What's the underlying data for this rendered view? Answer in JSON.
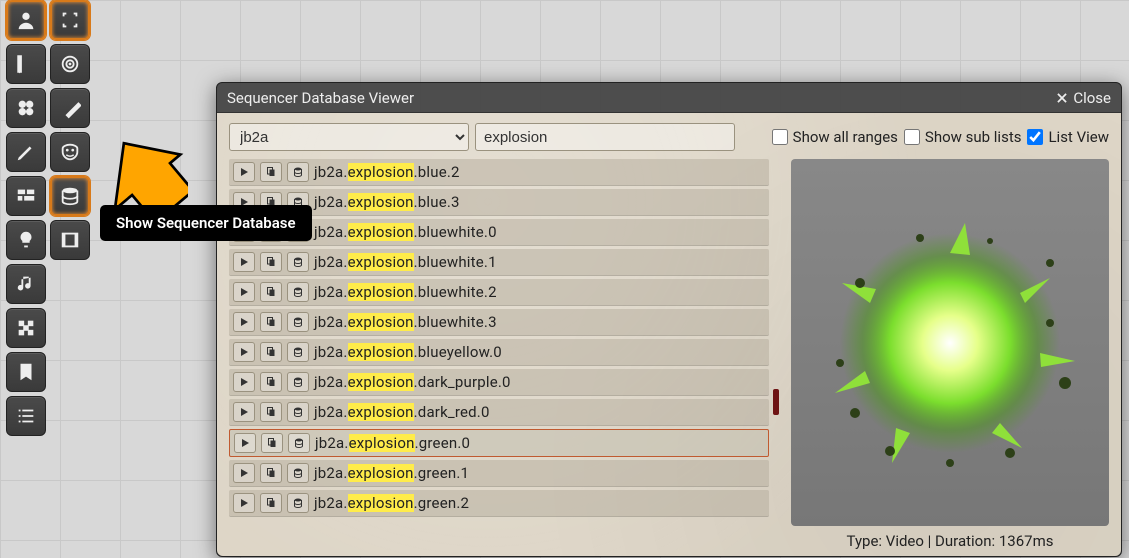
{
  "tooltip": "Show Sequencer Database",
  "window": {
    "title": "Sequencer Database Viewer",
    "close_label": "Close"
  },
  "controls": {
    "select_value": "jb2a",
    "search_value": "explosion",
    "show_all_ranges": {
      "label": "Show all ranges",
      "checked": false
    },
    "show_sub_lists": {
      "label": "Show sub lists",
      "checked": false
    },
    "list_view": {
      "label": "List View",
      "checked": true
    }
  },
  "rows": [
    {
      "pre": "jb2a.",
      "hl": "explosion",
      "post": ".blue.2"
    },
    {
      "pre": "jb2a.",
      "hl": "explosion",
      "post": ".blue.3"
    },
    {
      "pre": "jb2a.",
      "hl": "explosion",
      "post": ".bluewhite.0"
    },
    {
      "pre": "jb2a.",
      "hl": "explosion",
      "post": ".bluewhite.1"
    },
    {
      "pre": "jb2a.",
      "hl": "explosion",
      "post": ".bluewhite.2"
    },
    {
      "pre": "jb2a.",
      "hl": "explosion",
      "post": ".bluewhite.3"
    },
    {
      "pre": "jb2a.",
      "hl": "explosion",
      "post": ".blueyellow.0"
    },
    {
      "pre": "jb2a.",
      "hl": "explosion",
      "post": ".dark_purple.0"
    },
    {
      "pre": "jb2a.",
      "hl": "explosion",
      "post": ".dark_red.0"
    },
    {
      "pre": "jb2a.",
      "hl": "explosion",
      "post": ".green.0",
      "selected": true
    },
    {
      "pre": "jb2a.",
      "hl": "explosion",
      "post": ".green.1"
    },
    {
      "pre": "jb2a.",
      "hl": "explosion",
      "post": ".green.2"
    }
  ],
  "preview": {
    "footer": "Type: Video | Duration: 1367ms"
  }
}
